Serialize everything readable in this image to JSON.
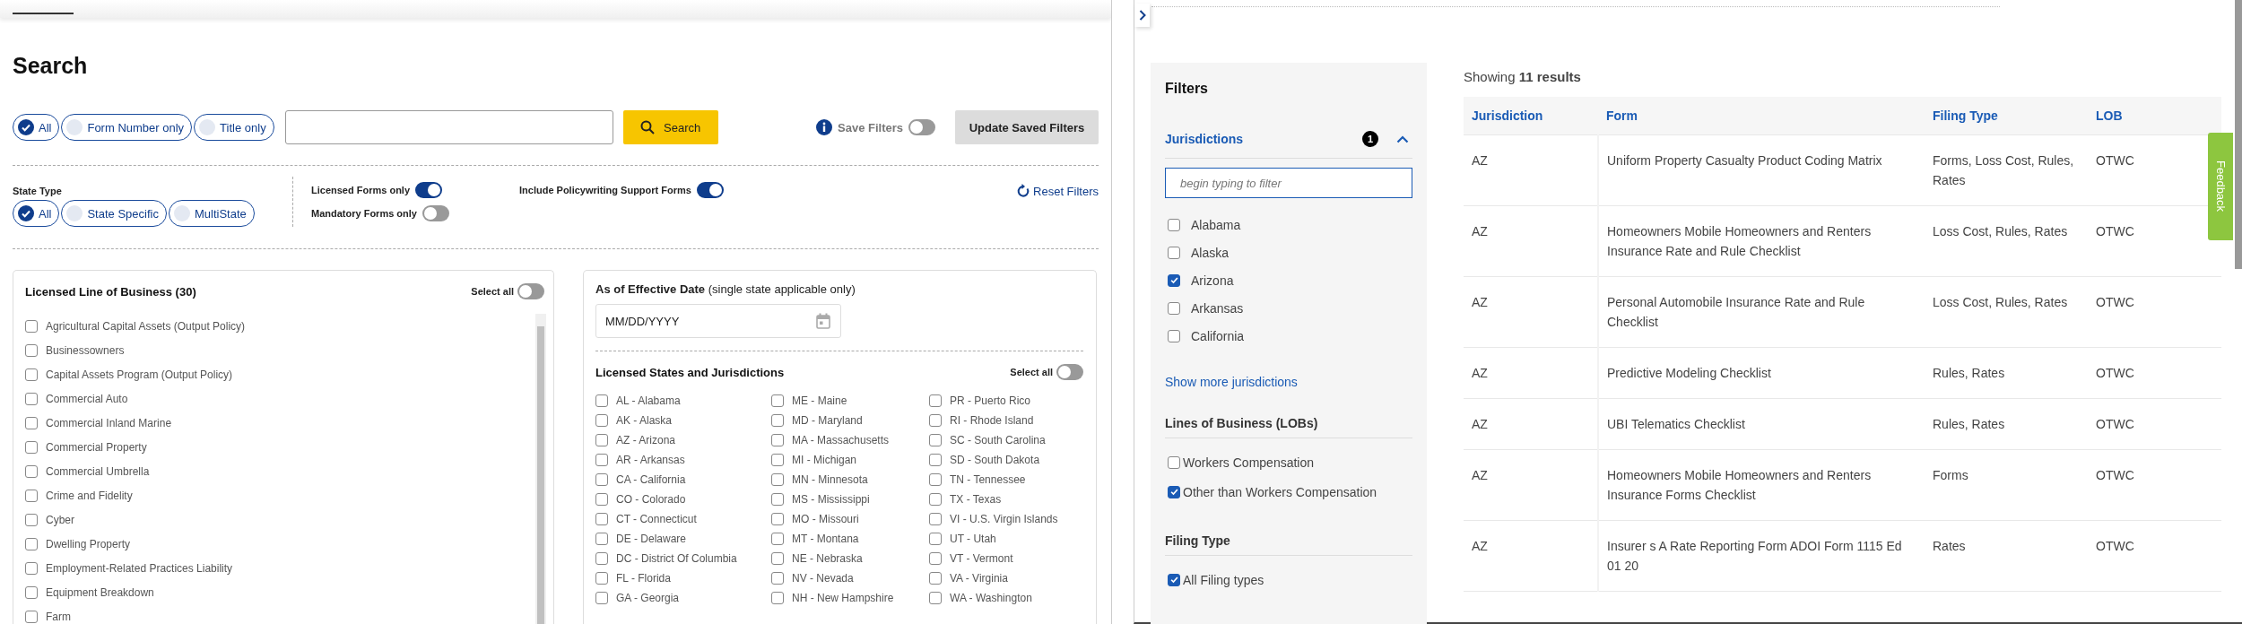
{
  "search_page": {
    "title": "Search",
    "scope_options": [
      {
        "label": "All",
        "selected": true
      },
      {
        "label": "Form Number only",
        "selected": false
      },
      {
        "label": "Title only",
        "selected": false
      }
    ],
    "search_button": "Search",
    "save_filters": {
      "label": "Save Filters",
      "on": false
    },
    "update_button": "Update Saved Filters",
    "state_type": {
      "label": "State Type",
      "options": [
        {
          "label": "All",
          "selected": true
        },
        {
          "label": "State Specific",
          "selected": false
        },
        {
          "label": "MultiState",
          "selected": false
        }
      ]
    },
    "toggles": [
      {
        "label": "Licensed Forms only",
        "on": true
      },
      {
        "label": "Mandatory Forms only",
        "on": false
      },
      {
        "label": "Include Policywriting Support Forms",
        "on": true
      }
    ],
    "reset_link": "Reset Filters",
    "lob_card": {
      "title": "Licensed Line of Business (30)",
      "select_all": {
        "label": "Select all",
        "on": false
      },
      "items": [
        {
          "label": "Agricultural Capital Assets (Output Policy)",
          "checked": false
        },
        {
          "label": "Businessowners",
          "checked": false
        },
        {
          "label": "Capital Assets Program (Output Policy)",
          "checked": false
        },
        {
          "label": "Commercial Auto",
          "checked": false
        },
        {
          "label": "Commercial Inland Marine",
          "checked": false
        },
        {
          "label": "Commercial Property",
          "checked": false
        },
        {
          "label": "Commercial Umbrella",
          "checked": false
        },
        {
          "label": "Crime and Fidelity",
          "checked": false
        },
        {
          "label": "Cyber",
          "checked": false
        },
        {
          "label": "Dwelling Property",
          "checked": false
        },
        {
          "label": "Employment-Related Practices Liability",
          "checked": false
        },
        {
          "label": "Equipment Breakdown",
          "checked": false
        },
        {
          "label": "Farm",
          "checked": false
        }
      ]
    },
    "date_card": {
      "title": "**As of Effective Date** (single state applicable only)",
      "date_field": {
        "placeholder": "MM/DD/YYYY"
      },
      "states_title": "Licensed States and Jurisdictions",
      "select_all": {
        "label": "Select all",
        "on": false
      },
      "state_columns": [
        {
          "items": [
            {
              "label": "AL - Alabama",
              "checked": false
            },
            {
              "label": "AK - Alaska",
              "checked": false
            },
            {
              "label": "AZ - Arizona",
              "checked": false
            },
            {
              "label": "AR - Arkansas",
              "checked": false
            },
            {
              "label": "CA - California",
              "checked": false
            },
            {
              "label": "CO - Colorado",
              "checked": false
            },
            {
              "label": "CT - Connecticut",
              "checked": false
            },
            {
              "label": "DE - Delaware",
              "checked": false
            },
            {
              "label": "DC - District Of Columbia",
              "checked": false
            },
            {
              "label": "FL - Florida",
              "checked": false
            },
            {
              "label": "GA - Georgia",
              "checked": false
            }
          ]
        },
        {
          "items": [
            {
              "label": "ME - Maine",
              "checked": false
            },
            {
              "label": "MD - Maryland",
              "checked": false
            },
            {
              "label": "MA - Massachusetts",
              "checked": false
            },
            {
              "label": "MI - Michigan",
              "checked": false
            },
            {
              "label": "MN - Minnesota",
              "checked": false
            },
            {
              "label": "MS - Mississippi",
              "checked": false
            },
            {
              "label": "MO - Missouri",
              "checked": false
            },
            {
              "label": "MT - Montana",
              "checked": false
            },
            {
              "label": "NE - Nebraska",
              "checked": false
            },
            {
              "label": "NV - Nevada",
              "checked": false
            },
            {
              "label": "NH - New Hampshire",
              "checked": false
            }
          ]
        },
        {
          "items": [
            {
              "label": "PR - Puerto Rico",
              "checked": false
            },
            {
              "label": "RI - Rhode Island",
              "checked": false
            },
            {
              "label": "SC - South Carolina",
              "checked": false
            },
            {
              "label": "SD - South Dakota",
              "checked": false
            },
            {
              "label": "TN - Tennessee",
              "checked": false
            },
            {
              "label": "TX - Texas",
              "checked": false
            },
            {
              "label": "VI - U.S. Virgin Islands",
              "checked": false
            },
            {
              "label": "UT - Utah",
              "checked": false
            },
            {
              "label": "VT - Vermont",
              "checked": false
            },
            {
              "label": "VA - Virginia",
              "checked": false
            },
            {
              "label": "WA - Washington",
              "checked": false
            }
          ]
        }
      ]
    }
  },
  "results_page": {
    "sidebar": {
      "title": "Filters",
      "sections": [
        {
          "kind": "jurisdictions",
          "title": "Jurisdictions",
          "badge": "1",
          "expanded": true,
          "filter_placeholder": "begin typing to filter",
          "items": [
            {
              "label": "Alabama",
              "checked": false
            },
            {
              "label": "Alaska",
              "checked": false
            },
            {
              "label": "Arizona",
              "checked": true
            },
            {
              "label": "Arkansas",
              "checked": false
            },
            {
              "label": "California",
              "checked": false
            }
          ],
          "more_link": "Show more jurisdictions"
        },
        {
          "kind": "plain",
          "title": "Lines of Business (LOBs)",
          "items": [
            {
              "label": "Workers Compensation",
              "checked": false
            },
            {
              "label": "Other than Workers Compensation",
              "checked": true
            }
          ]
        },
        {
          "kind": "plain",
          "title": "Filing Type",
          "items": [
            {
              "label": "All Filing types",
              "checked": true
            }
          ]
        }
      ]
    },
    "summary": "Showing **11 results**",
    "table": {
      "columns": [
        "Jurisdiction",
        "Form",
        "Filing Type",
        "LOB"
      ],
      "rows": [
        [
          "AZ",
          "Uniform Property Casualty Product Coding Matrix",
          "Forms, Loss Cost, Rules, Rates",
          "OTWC"
        ],
        [
          "AZ",
          "Homeowners Mobile Homeowners and Renters Insurance Rate and Rule Checklist",
          "Loss Cost, Rules, Rates",
          "OTWC"
        ],
        [
          "AZ",
          "Personal Automobile Insurance Rate and Rule Checklist",
          "Loss Cost, Rules, Rates",
          "OTWC"
        ],
        [
          "AZ",
          "Predictive Modeling Checklist",
          "Rules, Rates",
          "OTWC"
        ],
        [
          "AZ",
          "UBI Telematics Checklist",
          "Rules, Rates",
          "OTWC"
        ],
        [
          "AZ",
          "Homeowners Mobile Homeowners and Renters Insurance Forms Checklist",
          "Forms",
          "OTWC"
        ],
        [
          "AZ",
          "Insurer s A Rate Reporting Form ADOI Form 1115 Ed 01 20",
          "Rates",
          "OTWC"
        ]
      ]
    },
    "feedback_tab": "Feedback"
  }
}
